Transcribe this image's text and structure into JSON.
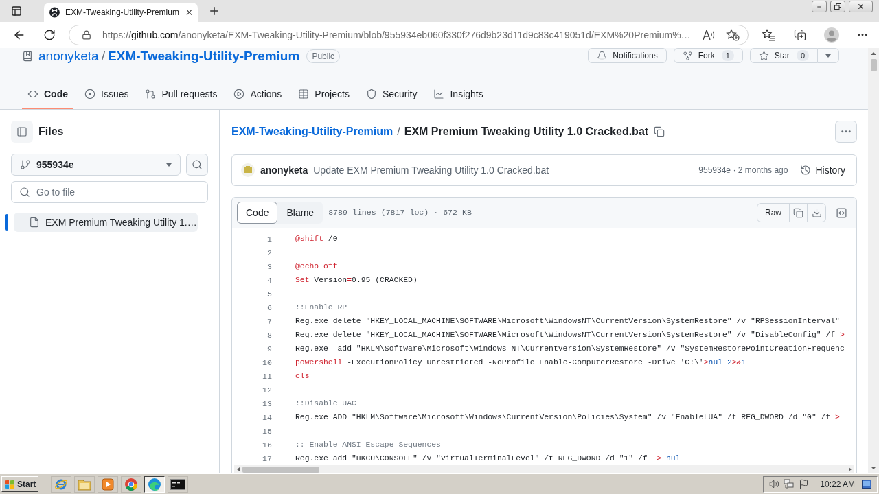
{
  "browser": {
    "tabs": [
      {
        "title": "EXM-Tweaking-Utility-Premium",
        "selected": true
      }
    ],
    "url": {
      "scheme": "https://",
      "host": "github.com",
      "path": "/anonyketa/EXM-Tweaking-Utility-Premium/blob/955934eb060f330f276d9b23d11d9c83c419051d/EXM%20Premium%…"
    }
  },
  "github": {
    "repo": {
      "owner": "anonyketa",
      "separator": "/",
      "name": "EXM-Tweaking-Utility-Premium",
      "visibility": "Public"
    },
    "actions": [
      {
        "kind": "notifications",
        "label": "Notifications"
      },
      {
        "kind": "fork",
        "label": "Fork",
        "count": "1"
      },
      {
        "kind": "star",
        "label": "Star",
        "count": "0"
      }
    ],
    "nav": [
      {
        "kind": "code",
        "label": "Code",
        "selected": true
      },
      {
        "kind": "issues",
        "label": "Issues",
        "selected": false
      },
      {
        "kind": "pulls",
        "label": "Pull requests",
        "selected": false
      },
      {
        "kind": "actions",
        "label": "Actions",
        "selected": false
      },
      {
        "kind": "projects",
        "label": "Projects",
        "selected": false
      },
      {
        "kind": "security",
        "label": "Security",
        "selected": false
      },
      {
        "kind": "insights",
        "label": "Insights",
        "selected": false
      }
    ]
  },
  "sidebar": {
    "title": "Files",
    "branch": "955934e",
    "search": {
      "placeholder": "Go to file"
    },
    "files": [
      {
        "name": "EXM Premium Tweaking Utility 1.…",
        "selected": true
      }
    ]
  },
  "file": {
    "breadcrumb": {
      "repo": "EXM-Tweaking-Utility-Premium",
      "separator": "/",
      "name": "EXM Premium Tweaking Utility 1.0 Cracked.bat"
    },
    "commit": {
      "author": "anonyketa",
      "message": "Update EXM Premium Tweaking Utility 1.0 Cracked.bat",
      "meta": "955934e · 2 months ago",
      "history": "History"
    },
    "view_tabs": [
      {
        "label": "Code",
        "selected": true
      },
      {
        "label": "Blame",
        "selected": false
      }
    ],
    "stats": "8789 lines (7817 loc) · 672 KB",
    "raw": "Raw",
    "lines": [
      {
        "number": "1",
        "tokens": [
          {
            "kind": "keyword",
            "text": "@shift"
          },
          {
            "kind": "plain",
            "text": " /0"
          }
        ]
      },
      {
        "number": "2"
      },
      {
        "number": "3",
        "tokens": [
          {
            "kind": "keyword",
            "text": "@echo off"
          }
        ]
      },
      {
        "number": "4",
        "tokens": [
          {
            "kind": "keyword",
            "text": "Set"
          },
          {
            "kind": "plain",
            "text": " Version"
          },
          {
            "kind": "operator",
            "text": "="
          },
          {
            "kind": "plain",
            "text": "0.95 (CRACKED)"
          }
        ]
      },
      {
        "number": "5"
      },
      {
        "number": "6",
        "tokens": [
          {
            "kind": "comment",
            "text": "::Enable RP"
          }
        ]
      },
      {
        "number": "7",
        "tokens": [
          {
            "kind": "plain",
            "text": "Reg.exe delete \"HKEY_LOCAL_MACHINE\\SOFTWARE\\Microsoft\\WindowsNT\\CurrentVersion\\SystemRestore\" /v \"RPSessionInterval\""
          }
        ]
      },
      {
        "number": "8",
        "tokens": [
          {
            "kind": "plain",
            "text": "Reg.exe delete \"HKEY_LOCAL_MACHINE\\SOFTWARE\\Microsoft\\WindowsNT\\CurrentVersion\\SystemRestore\" /v \"DisableConfig\" /f "
          },
          {
            "kind": "operator",
            "text": ">"
          }
        ]
      },
      {
        "number": "9",
        "tokens": [
          {
            "kind": "plain",
            "text": "Reg.exe  add \"HKLM\\Software\\Microsoft\\Windows NT\\CurrentVersion\\SystemRestore\" /v \"SystemRestorePointCreationFrequenc"
          }
        ]
      },
      {
        "number": "10",
        "tokens": [
          {
            "kind": "keyword",
            "text": "powershell"
          },
          {
            "kind": "plain",
            "text": " -ExecutionPolicy Unrestricted -NoProfile Enable-ComputerRestore -Drive 'C:\\'"
          },
          {
            "kind": "operator",
            "text": ">"
          },
          {
            "kind": "constant",
            "text": "nul 2"
          },
          {
            "kind": "operator",
            "text": ">&"
          },
          {
            "kind": "constant",
            "text": "1"
          }
        ]
      },
      {
        "number": "11",
        "tokens": [
          {
            "kind": "keyword",
            "text": "cls"
          }
        ]
      },
      {
        "number": "12"
      },
      {
        "number": "13",
        "tokens": [
          {
            "kind": "comment",
            "text": "::Disable UAC"
          }
        ]
      },
      {
        "number": "14",
        "tokens": [
          {
            "kind": "plain",
            "text": "Reg.exe ADD \"HKLM\\Software\\Microsoft\\Windows\\CurrentVersion\\Policies\\System\" /v \"EnableLUA\" /t REG_DWORD /d \"0\" /f "
          },
          {
            "kind": "operator",
            "text": ">"
          }
        ]
      },
      {
        "number": "15"
      },
      {
        "number": "16",
        "tokens": [
          {
            "kind": "comment",
            "text": ":: Enable ANSI Escape Sequences"
          }
        ]
      },
      {
        "number": "17",
        "tokens": [
          {
            "kind": "plain",
            "text": "Reg.exe add \"HKCU\\CONSOLE\" /v \"VirtualTerminalLevel\" /t REG_DWORD /d \"1\" /f  "
          },
          {
            "kind": "operator",
            "text": ">"
          },
          {
            "kind": "constant",
            "text": " nul"
          }
        ]
      }
    ]
  },
  "taskbar": {
    "start": "Start",
    "apps": [
      {
        "kind": "ie",
        "selected": false
      },
      {
        "kind": "explorer",
        "selected": false
      },
      {
        "kind": "media",
        "selected": false
      },
      {
        "kind": "chrome",
        "selected": false
      },
      {
        "kind": "edge",
        "selected": true
      },
      {
        "kind": "cmd",
        "selected": false
      }
    ],
    "clock": "10:22 AM"
  }
}
